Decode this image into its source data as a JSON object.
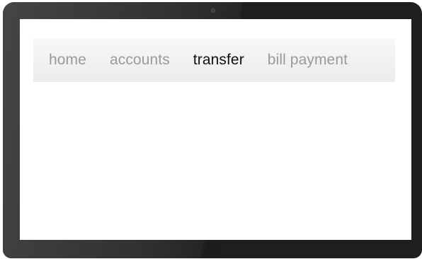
{
  "device": {
    "bezel_color": "#1e1e1e",
    "screen_color": "#ffffff"
  },
  "nav": {
    "background": "#efefef",
    "inactive_color": "#9a9a9a",
    "active_color": "#111111",
    "items": [
      {
        "label": "home",
        "active": false
      },
      {
        "label": "accounts",
        "active": false
      },
      {
        "label": "transfer",
        "active": true
      },
      {
        "label": "bill payment",
        "active": false
      }
    ]
  }
}
